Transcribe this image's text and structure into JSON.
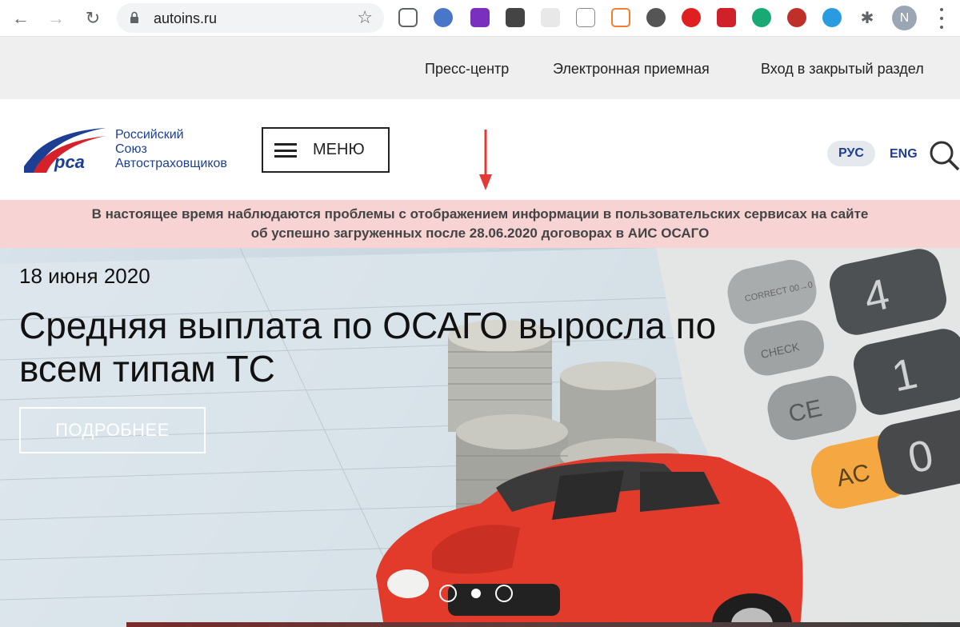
{
  "browser": {
    "url": "autoins.ru",
    "profile_initial": "N"
  },
  "topbar": {
    "links": [
      "Пресс-центр",
      "Электронная приемная",
      "Вход в закрытый раздел"
    ]
  },
  "header": {
    "logo_lines": [
      "Российский",
      "Союз",
      "Автостраховщиков"
    ],
    "logo_mark_text": "рса",
    "menu_label": "МЕНЮ",
    "lang_active": "РУС",
    "lang_other": "ENG"
  },
  "notice": {
    "line1": "В настоящее время наблюдаются проблемы с отображением информации в пользовательских сервисах на сайте",
    "line2": "об успешно загруженных после 28.06.2020 договорах в АИС ОСАГО"
  },
  "hero": {
    "date": "18 июня 2020",
    "title": "Средняя выплата по ОСАГО выросла по всем типам ТС",
    "button_label": "ПОДРОБНЕЕ",
    "slides_count": 3,
    "active_slide": 2
  },
  "calculator_keys": [
    "CORRECT 00→0",
    "CHECK",
    "CE",
    "AC",
    "4",
    "1",
    "0"
  ],
  "colors": {
    "brand_blue": "#1c3f94",
    "notice_bg": "#f7d3d3",
    "arrow_red": "#e53935",
    "ac_key": "#f5a742",
    "car_red": "#e23b2c"
  }
}
